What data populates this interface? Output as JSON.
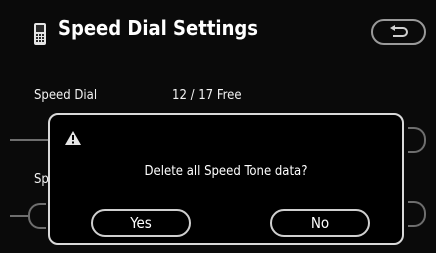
{
  "header": {
    "title": "Speed Dial Settings",
    "icon": "phone-icon",
    "back_icon": "return-arrow-icon"
  },
  "rows": [
    {
      "label": "Speed Dial",
      "value": "12 / 17  Free"
    },
    {
      "label": "Sp"
    }
  ],
  "dialog": {
    "icon": "warning-icon",
    "message": "Delete all Speed Tone data?",
    "yes_label": "Yes",
    "no_label": "No"
  },
  "colors": {
    "background": "#0a0a0a",
    "text": "#ffffff",
    "border": "#d9d9d9",
    "dim_line": "#6e6e6e"
  }
}
